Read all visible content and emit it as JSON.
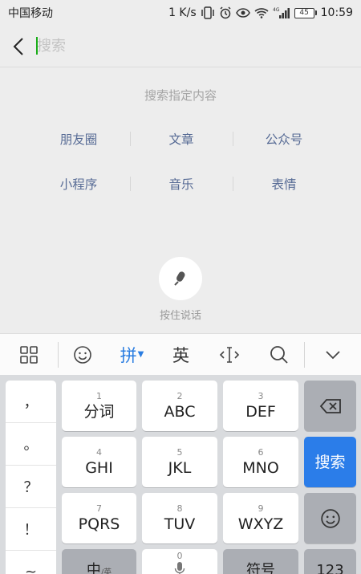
{
  "status_bar": {
    "carrier": "中国移动",
    "speed": "1 K/s",
    "network": "4G",
    "battery": "45",
    "time": "10:59"
  },
  "search": {
    "placeholder": "搜索"
  },
  "hint": {
    "title": "搜索指定内容",
    "categories": [
      "朋友圈",
      "文章",
      "公众号",
      "小程序",
      "音乐",
      "表情"
    ]
  },
  "voice": {
    "label": "按住说话"
  },
  "keyboard_toolbar": {
    "pinyin": "拼",
    "english": "英"
  },
  "keyboard": {
    "punctuation": [
      "，",
      "。",
      "？",
      "！",
      "~"
    ],
    "keys": [
      {
        "num": "1",
        "label": "分词"
      },
      {
        "num": "2",
        "label": "ABC"
      },
      {
        "num": "3",
        "label": "DEF"
      },
      {
        "num": "4",
        "label": "GHI"
      },
      {
        "num": "5",
        "label": "JKL"
      },
      {
        "num": "6",
        "label": "MNO"
      },
      {
        "num": "7",
        "label": "PQRS"
      },
      {
        "num": "8",
        "label": "TUV"
      },
      {
        "num": "9",
        "label": "WXYZ"
      },
      {
        "num": "0",
        "label": ""
      }
    ],
    "search_key": "搜索",
    "bottom": {
      "chinese": "中",
      "chinese_sub": "/英",
      "symbols": "符号",
      "numbers": "123"
    }
  }
}
